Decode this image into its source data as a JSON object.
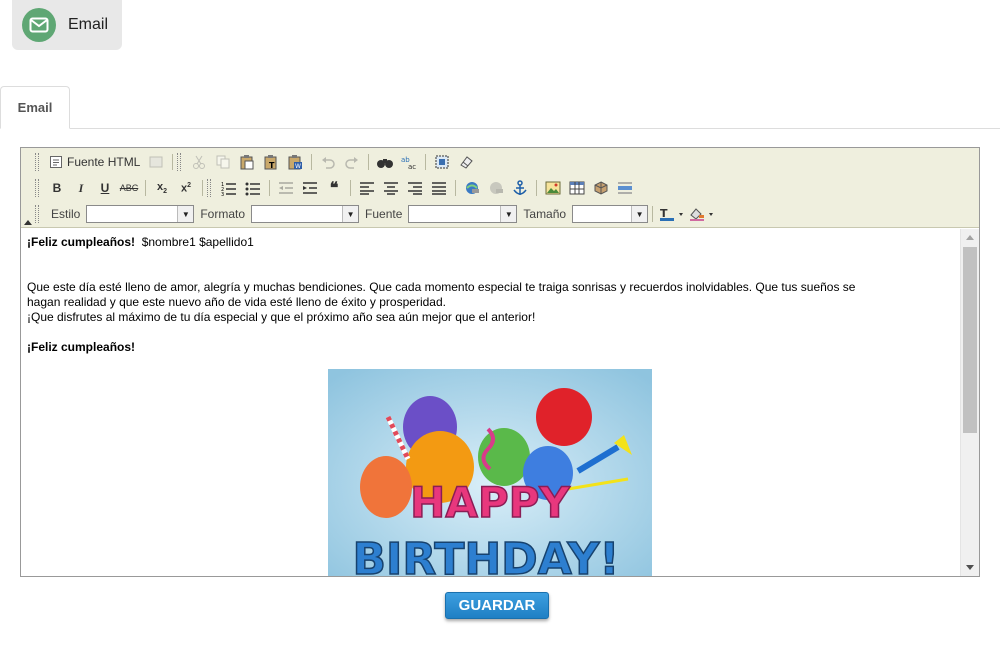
{
  "header": {
    "title": "Email",
    "icon": "envelope-icon",
    "accent": "#5fa774"
  },
  "tabs": [
    {
      "label": "Email",
      "active": true
    }
  ],
  "editor": {
    "toolbar": {
      "source_label": "Fuente HTML",
      "combos": {
        "style_label": "Estilo",
        "format_label": "Formato",
        "font_label": "Fuente",
        "size_label": "Tamaño"
      }
    },
    "content": {
      "greeting": "¡Feliz cumpleaños!",
      "placeholders": "$nombre1 $apellido1",
      "line1": "Que este día esté lleno de amor, alegría y muchas bendiciones. Que cada momento especial te traiga sonrisas y recuerdos inolvidables. Que tus sueños se",
      "line2": "hagan realidad y que este nuevo año de vida esté lleno de éxito y prosperidad.",
      "line3": "¡Que disfrutes al máximo de tu día especial y que el próximo año sea aún mejor que el anterior!",
      "closing": "¡Feliz cumpleaños!",
      "image_text_1": "HAPPY",
      "image_text_2": "BIRTHDAY!"
    }
  },
  "actions": {
    "save_label": "GUARDAR",
    "save_color": "#2a8fd6"
  }
}
